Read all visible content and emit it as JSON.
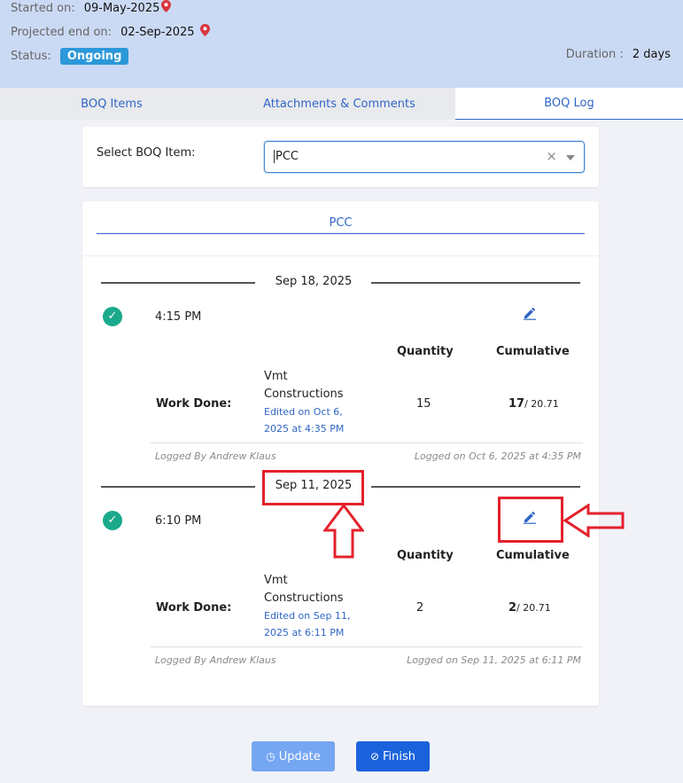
{
  "header": {
    "started_label": "Started on:",
    "started_value": "09-May-2025",
    "projected_label": "Projected end on:",
    "projected_value": "02-Sep-2025",
    "status_label": "Status:",
    "status_value": "Ongoing",
    "duration_label": "Duration :",
    "duration_value": "2 days"
  },
  "tabs": [
    {
      "label": "BOQ Items"
    },
    {
      "label": "Attachments & Comments"
    },
    {
      "label": "BOQ Log"
    }
  ],
  "select": {
    "label": "Select BOQ Item:",
    "value": "PCC",
    "clear": "×"
  },
  "log": {
    "title": "PCC",
    "quantity_header": "Quantity",
    "cumulative_header": "Cumulative",
    "work_done_label": "Work Done:",
    "entries": [
      {
        "date": "Sep 18, 2025",
        "time": "4:15 PM",
        "work": "Vmt Constructions",
        "edited": "Edited on Oct 6, 2025 at 4:35 PM",
        "quantity": "15",
        "cumulative": "17",
        "cumulative_total": "/ 20.71",
        "logged_by": "Logged By Andrew Klaus",
        "logged_on": "Logged on Oct 6, 2025 at 4:35 PM"
      },
      {
        "date": "Sep 11, 2025",
        "time": "6:10 PM",
        "work": "Vmt Constructions",
        "edited": "Edited on Sep 11, 2025 at 6:11 PM",
        "quantity": "2",
        "cumulative": "2",
        "cumulative_total": "/ 20.71",
        "logged_by": "Logged By Andrew Klaus",
        "logged_on": "Logged on Sep 11, 2025 at 6:11 PM"
      }
    ]
  },
  "buttons": {
    "update": "Update",
    "finish": "Finish"
  },
  "icons": {
    "pin": "map-pin-icon",
    "check": "check-circle-icon",
    "edit": "pencil-icon",
    "update": "clock-icon",
    "finish": "check-circle-outline-icon"
  },
  "colors": {
    "header_bg": "#cbdaf4",
    "accent": "#2f66c6",
    "status_badge": "#2b98d9",
    "check_green": "#1ba98c",
    "highlight_red": "#e3212c",
    "finish_button": "#1a62dc",
    "update_button": "#75a6f2"
  }
}
